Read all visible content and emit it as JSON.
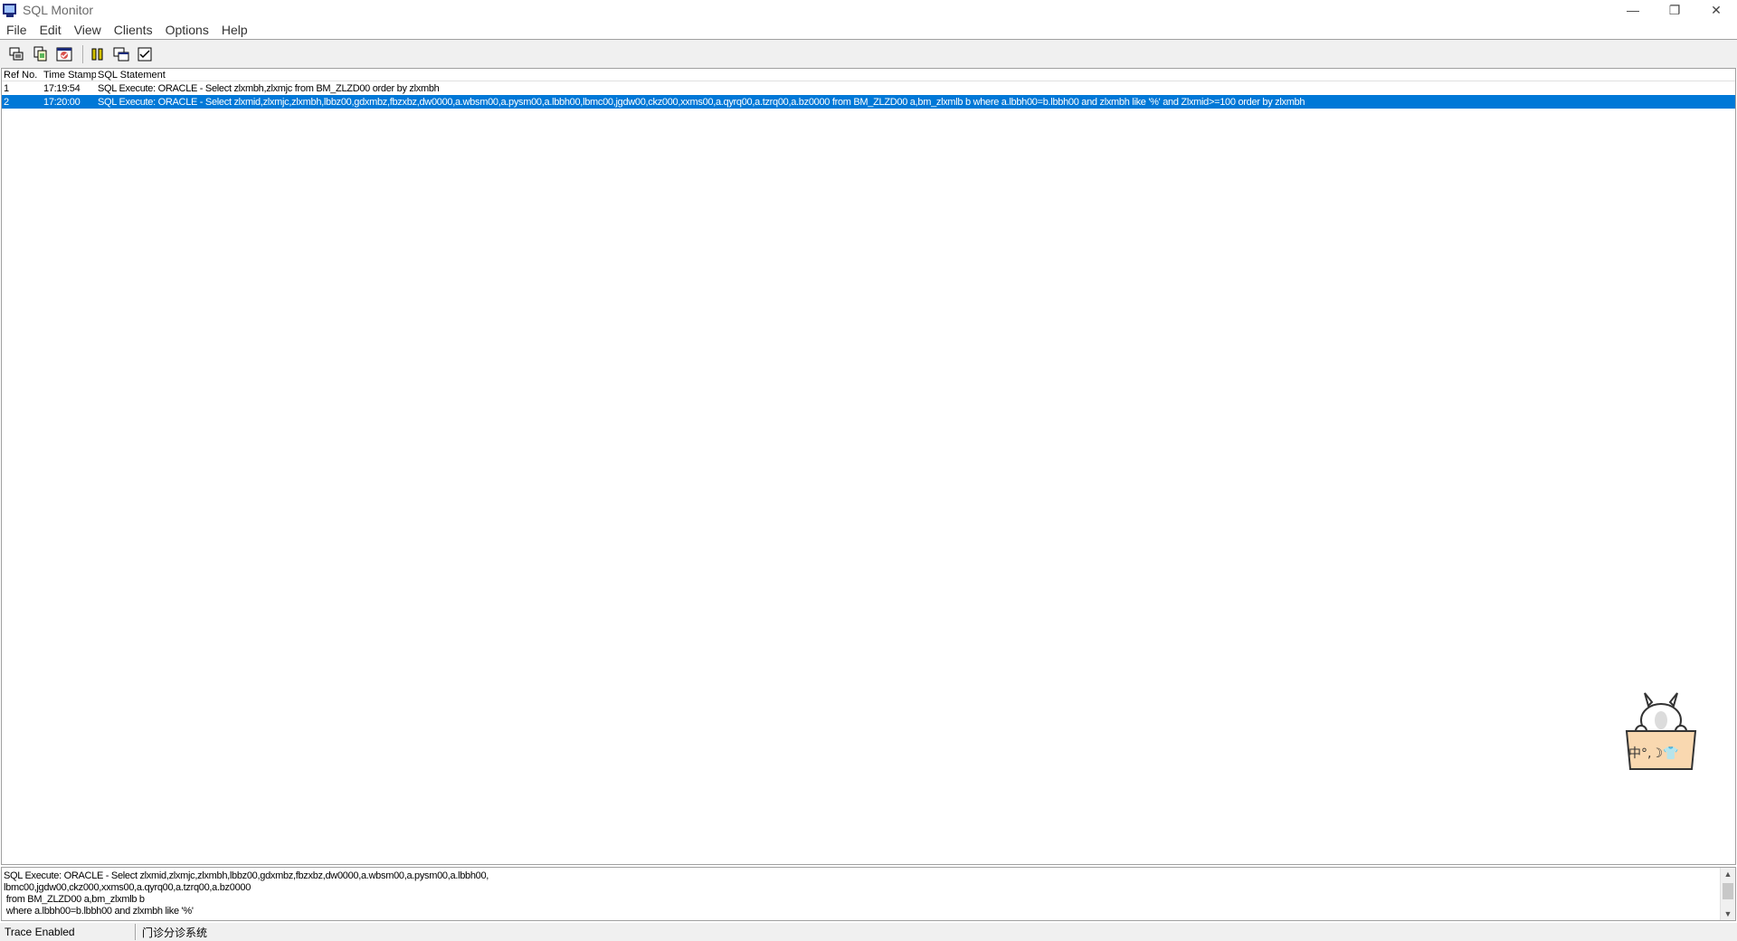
{
  "window": {
    "title": "SQL Monitor",
    "minimize_glyph": "—",
    "restore_glyph": "❐",
    "close_glyph": "✕"
  },
  "menu": [
    "File",
    "Edit",
    "View",
    "Clients",
    "Options",
    "Help"
  ],
  "toolbar": {
    "icons": [
      "save-log-icon",
      "copy-icon",
      "print-icon",
      "pause-icon",
      "clients-icon",
      "options-checklist-icon"
    ]
  },
  "list": {
    "headers": {
      "ref": "Ref No.",
      "time": "Time Stamp",
      "sql": "SQL Statement"
    },
    "rows": [
      {
        "ref": "1",
        "time": "17:19:54",
        "sql": "SQL Execute: ORACLE - Select zlxmbh,zlxmjc from BM_ZLZD00 order by zlxmbh"
      },
      {
        "ref": "2",
        "time": "17:20:00",
        "sql": "SQL Execute: ORACLE - Select zlxmid,zlxmjc,zlxmbh,lbbz00,gdxmbz,fbzxbz,dw0000,a.wbsm00,a.pysm00,a.lbbh00,lbmc00,jgdw00,ckz000,xxms00,a.qyrq00,a.tzrq00,a.bz0000 from BM_ZLZD00 a,bm_zlxmlb b where a.lbbh00=b.lbbh00 and zlxmbh like '%' and Zlxmid>=100 order by zlxmbh"
      }
    ],
    "selected_row": 2
  },
  "detail": {
    "lines": [
      "SQL Execute: ORACLE - Select zlxmid,zlxmjc,zlxmbh,lbbz00,gdxmbz,fbzxbz,dw0000,a.wbsm00,a.pysm00,a.lbbh00,",
      "lbmc00,jgdw00,ckz000,xxms00,a.qyrq00,a.tzrq00,a.bz0000",
      " from BM_ZLZD00 a,bm_zlxmlb b",
      " where a.lbbh00=b.lbbh00 and zlxmbh like '%'"
    ]
  },
  "status": {
    "pane1": "Trace Enabled",
    "pane2": "门诊分诊系统"
  },
  "ime": {
    "label": "中°,☽👕"
  },
  "colors": {
    "selection": "#0078d7",
    "toolbar_bg": "#f0f0f0"
  }
}
